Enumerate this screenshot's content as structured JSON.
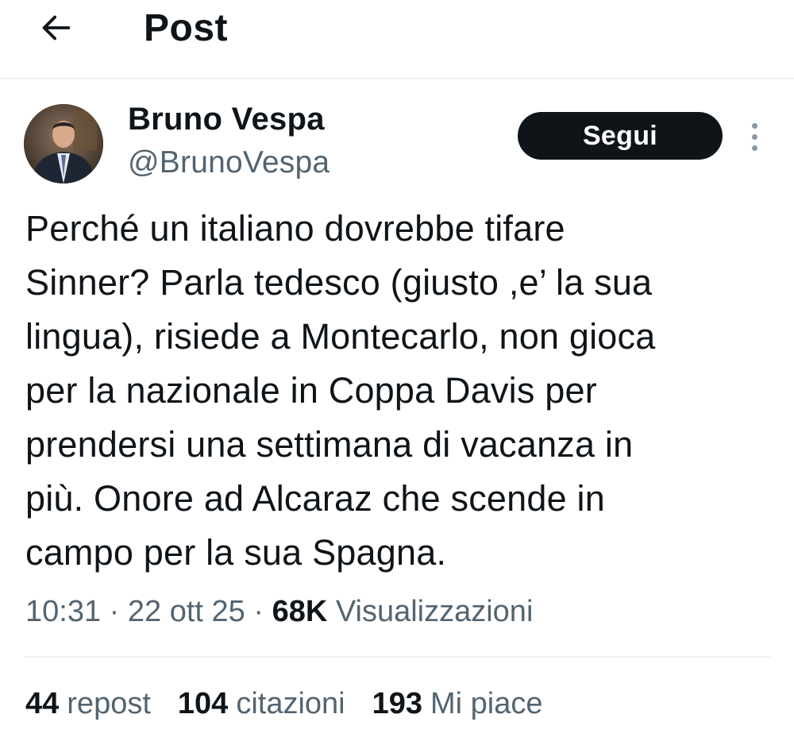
{
  "header": {
    "title": "Post",
    "back_icon": "arrow-left-icon"
  },
  "author": {
    "display_name": "Bruno Vespa",
    "handle": "@BrunoVespa",
    "follow_label": "Segui",
    "more_icon": "more-vertical-icon"
  },
  "post": {
    "text": "Perché un italiano dovrebbe tifare\nSinner? Parla tedesco (giusto ,e’ la sua\nlingua), risiede a Montecarlo, non gioca\nper la nazionale in Coppa Davis per\nprendersi una settimana di vacanza in\npiù. Onore ad Alcaraz che scende in\ncampo per la sua Spagna.",
    "time": "10:31",
    "date": "22 ott 25",
    "separator": "·",
    "views_count": "68K",
    "views_label": "Visualizzazioni"
  },
  "stats": [
    {
      "count": "44",
      "label": "repost"
    },
    {
      "count": "104",
      "label": "citazioni"
    },
    {
      "count": "193",
      "label": "Mi piace"
    }
  ],
  "colors": {
    "text_primary": "#0f1419",
    "text_secondary": "#536471",
    "divider": "#eff3f4",
    "button_bg": "#0f1419"
  }
}
